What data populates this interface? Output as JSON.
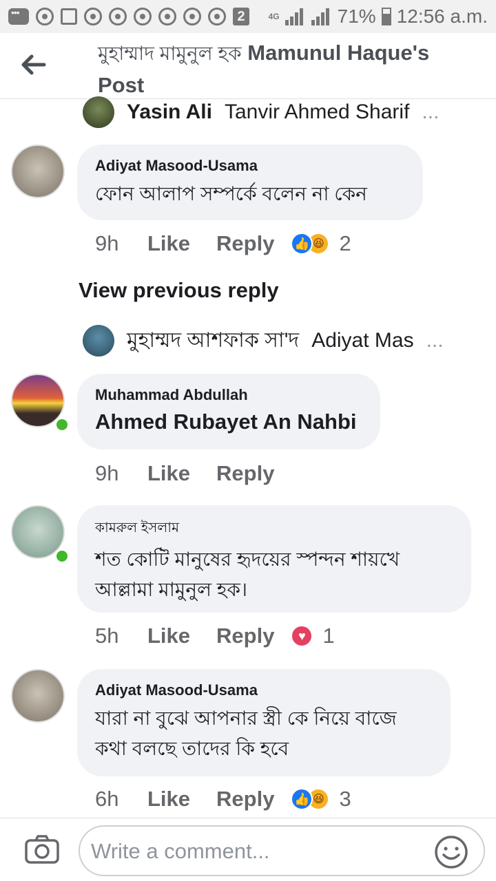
{
  "status_bar": {
    "network": "4G",
    "battery": "71%",
    "time": "12:56 a.m.",
    "badge": "2"
  },
  "header": {
    "title_bn": "মুহাম্মাদ মামুনুল হক",
    "title_en": "Mamunul Haque's Post"
  },
  "reply_row_1": {
    "name": "Yasin Ali",
    "preview": "Tanvir Ahmed Sharif",
    "ellipsis": "..."
  },
  "comments": [
    {
      "author": "Adiyat Masood-Usama",
      "text": "ফোন আলাপ সম্পর্কে বলেন না কেন",
      "time": "9h",
      "like": "Like",
      "reply": "Reply",
      "reactions": [
        "like",
        "haha"
      ],
      "reaction_count": "2"
    },
    {
      "author": "Muhammad Abdullah",
      "text": "Ahmed Rubayet An Nahbi",
      "time": "9h",
      "like": "Like",
      "reply": "Reply"
    },
    {
      "author": "কামরুল ইসলাম",
      "text_line1": "শত কোটি মানুষের হৃদয়ের স্পন্দন শায়খে",
      "text_line2": "আল্লামা মামুনুল হক।",
      "time": "5h",
      "like": "Like",
      "reply": "Reply",
      "reactions": [
        "love"
      ],
      "reaction_count": "1"
    },
    {
      "author": "Adiyat Masood-Usama",
      "text_line1": "যারা না বুঝে আপনার স্ত্রী কে নিয়ে বাজে",
      "text_line2": "কথা বলছে তাদের কি হবে",
      "time": "6h",
      "like": "Like",
      "reply": "Reply",
      "reactions": [
        "like",
        "haha"
      ],
      "reaction_count": "3"
    }
  ],
  "view_previous": "View previous reply",
  "reply_row_2": {
    "name": "মুহাম্মদ আশফাক সা'দ",
    "preview": "Adiyat Mas",
    "ellipsis": "..."
  },
  "composer": {
    "placeholder": "Write a comment..."
  },
  "colors": {
    "like_blue": "#1877f2",
    "online_green": "#42b72a",
    "bubble_gray": "#f0f2f5",
    "love_red": "#e4405f"
  },
  "icons": [
    "back-arrow-icon",
    "camera-icon",
    "smiley-icon",
    "like-reaction-icon",
    "haha-reaction-icon",
    "love-reaction-icon"
  ]
}
